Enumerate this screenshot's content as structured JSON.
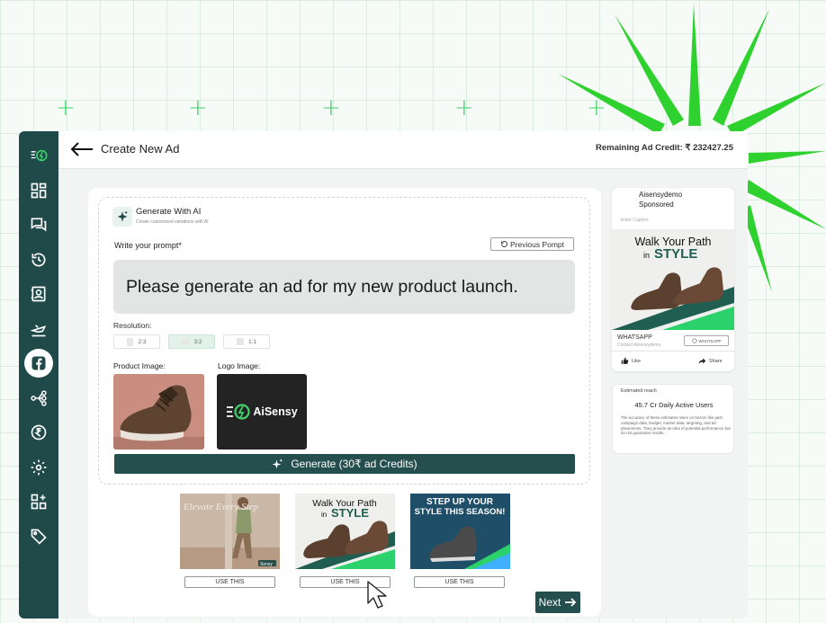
{
  "header": {
    "title": "Create New Ad",
    "credit": "Remaining Ad Credit: ₹ 232427.25"
  },
  "sidebar": {
    "items": [
      {
        "icon": "aisensy-logo-icon"
      },
      {
        "icon": "dashboard-grid-icon"
      },
      {
        "icon": "chat-icon"
      },
      {
        "icon": "history-icon"
      },
      {
        "icon": "contacts-icon"
      },
      {
        "icon": "broadcast-icon"
      },
      {
        "icon": "facebook-icon",
        "active": true
      },
      {
        "icon": "flow-icon"
      },
      {
        "icon": "rupee-icon"
      },
      {
        "icon": "settings-icon"
      },
      {
        "icon": "integrations-icon"
      },
      {
        "icon": "tag-icon"
      }
    ],
    "accent": "#1f4a49"
  },
  "generate": {
    "title": "Generate With AI",
    "subtitle": "Create customized variations with AI",
    "prompt_label": "Write your prompt*",
    "previous_prompt": "Previous Pompt",
    "prompt_value": "Please generate an ad for my new product launch.",
    "resolution_label": "Resolution:",
    "resolutions": [
      "2:3",
      "3:2",
      "1:1"
    ],
    "selected_resolution": "3:2",
    "product_image_label": "Product Image:",
    "logo_image_label": "Logo Image:",
    "logo_text": "AiSensy",
    "generate_button": "Generate (30₹ ad Credits)"
  },
  "variants": [
    {
      "overlay": "Elevate Every Step",
      "badge": "Sensy",
      "button": "USE THIS"
    },
    {
      "overlay": "Walk Your Path",
      "overlay_2": "in",
      "overlay_3": "STYLE",
      "button": "USE THIS"
    },
    {
      "overlay": "STEP UP YOUR",
      "overlay_2": "STYLE THIS SEASON!",
      "button": "USE THIS"
    }
  ],
  "next_button": "Next",
  "preview": {
    "brand": "Aisensydemo",
    "sponsored": "Sponsored",
    "caption_placeholder": "Enter Caption",
    "ad_line1": "Walk Your Path",
    "ad_line2_prefix": "in",
    "ad_line2_style": "STYLE",
    "cta_title": "WHATSAPP",
    "cta_contact": "Contact Aisensydemo",
    "cta_button": "WHATSAPP",
    "like": "Like",
    "share": "Share"
  },
  "reach": {
    "label": "Estimated reach",
    "value": "45.7 Cr Daily Active Users",
    "note": "The accuracy of these estimates relies on factors like past campaign data, budget, market data, targeting, and ad placements. They provide an idea of potential performance but do not guarantee results."
  },
  "colors": {
    "brand_dark": "#254f4e",
    "burst_green": "#2fd12f",
    "accent_green": "#14b86a"
  }
}
